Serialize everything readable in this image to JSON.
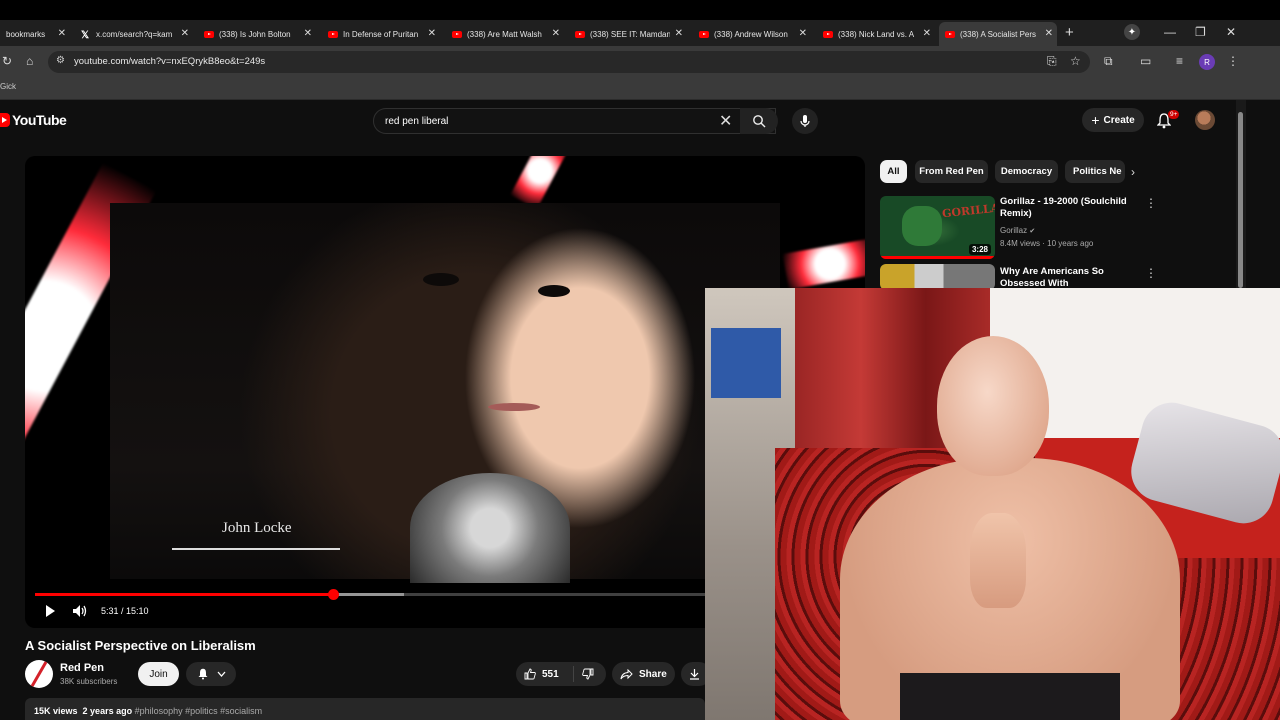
{
  "browser": {
    "tabs": [
      {
        "title": "bookmarks",
        "icon": "bookmark",
        "active": false
      },
      {
        "title": "x.com/search?q=kam",
        "icon": "x-icon",
        "active": false
      },
      {
        "title": "(338) Is John Bolton",
        "icon": "youtube-icon",
        "active": false
      },
      {
        "title": "In Defense of Puritan",
        "icon": "youtube-icon",
        "active": false
      },
      {
        "title": "(338) Are Matt Walsh",
        "icon": "youtube-icon",
        "active": false
      },
      {
        "title": "(338) SEE IT: Mamdani",
        "icon": "youtube-icon",
        "active": false
      },
      {
        "title": "(338) Andrew Wilson",
        "icon": "youtube-icon",
        "active": false
      },
      {
        "title": "(338) Nick Land vs. A",
        "icon": "youtube-icon",
        "active": false
      },
      {
        "title": "(338) A Socialist Pers",
        "icon": "youtube-icon",
        "active": true
      }
    ],
    "url": "youtube.com/watch?v=nxEQrykB8eo&t=249s",
    "bookmark_item": "Gick",
    "profile_initial": "R"
  },
  "youtube": {
    "logo_text": "YouTube",
    "search_query": "red pen liberal",
    "create_label": "Create",
    "notification_count": "9+"
  },
  "video": {
    "overlay_caption": "John Locke",
    "time": "5:31 / 15:10",
    "progress_played": 0.364,
    "progress_buffered": 0.45,
    "title": "A Socialist Perspective on Liberalism",
    "channel_name": "Red Pen",
    "subscribers": "38K subscribers",
    "join_label": "Join",
    "like_count": "551",
    "share_label": "Share",
    "views": "15K views",
    "age": "2 years ago",
    "hashtags": "#philosophy #politics #socialism"
  },
  "sidebar": {
    "chips": [
      {
        "label": "All",
        "active": true
      },
      {
        "label": "From Red Pen",
        "active": false
      },
      {
        "label": "Democracy",
        "active": false
      },
      {
        "label": "Politics Ne",
        "active": false
      }
    ],
    "recommendations": [
      {
        "title": "Gorillaz - 19-2000 (Soulchild Remix)",
        "channel": "Gorillaz",
        "meta": "8.4M views · 10 years ago",
        "duration": "3:28",
        "thumb_text": "GORILLAZ"
      },
      {
        "title": "Why Are Americans So Obsessed With Communism??",
        "channel": "",
        "meta": "",
        "duration": ""
      }
    ]
  },
  "colors": {
    "accent_red": "#ff0000",
    "background": "#0f0f0f",
    "chip_bg": "#272727"
  }
}
